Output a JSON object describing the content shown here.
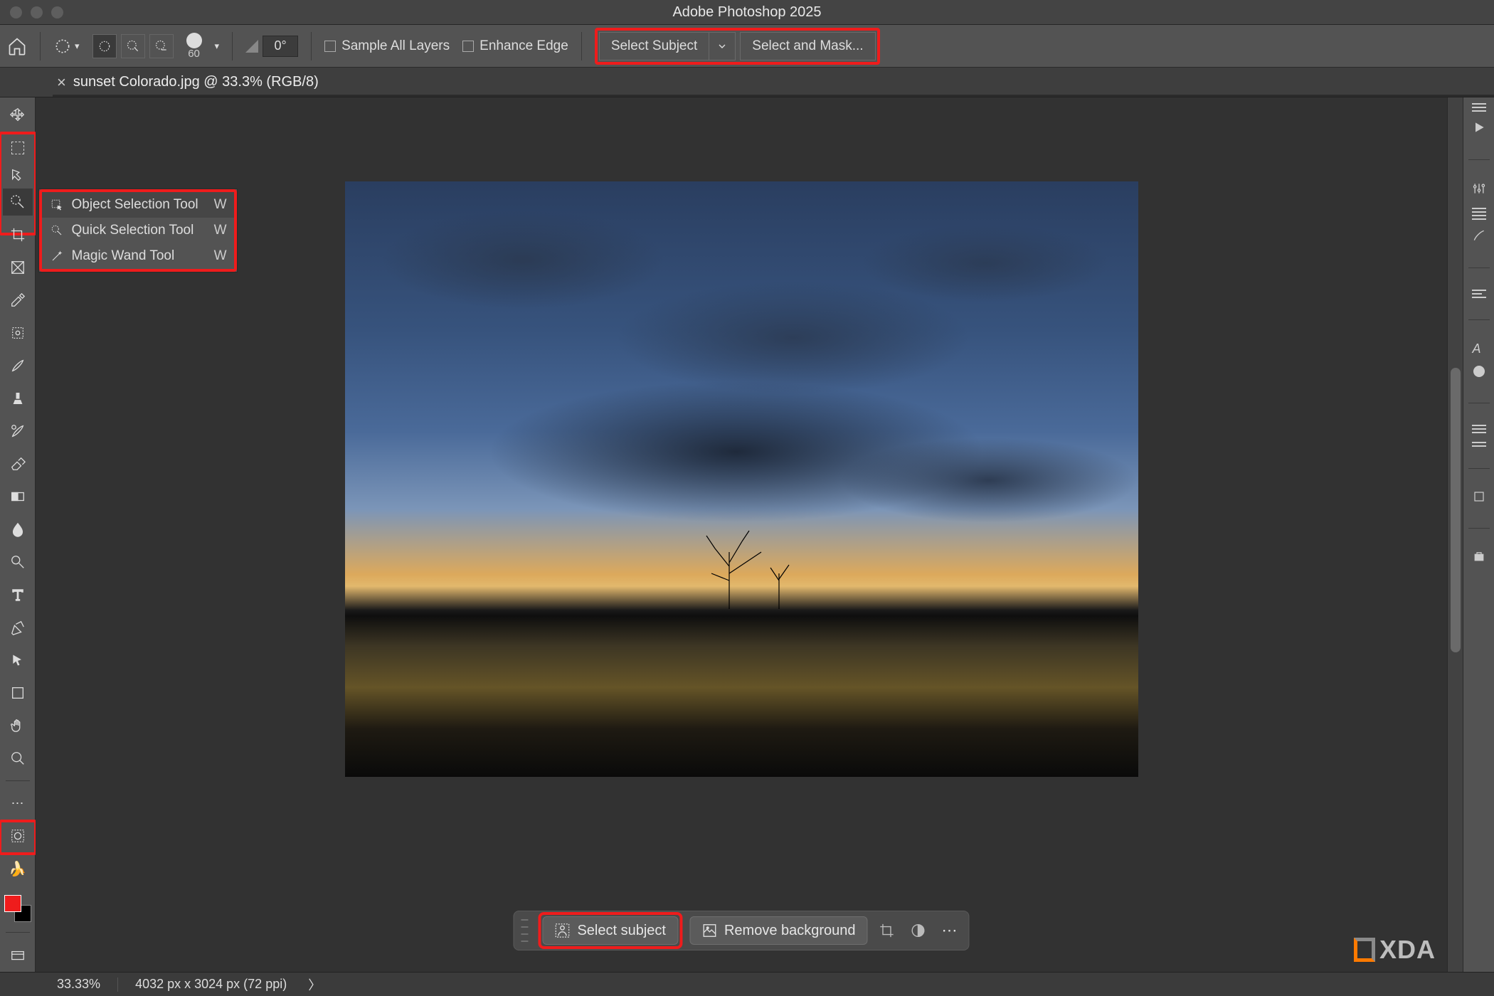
{
  "window": {
    "title": "Adobe Photoshop 2025"
  },
  "tab": {
    "filename": "sunset Colorado.jpg @ 33.3% (RGB/8)"
  },
  "options_bar": {
    "brush_size": "60",
    "angle": "0°",
    "sample_all_layers": "Sample All Layers",
    "enhance_edge": "Enhance Edge",
    "select_subject": "Select Subject",
    "select_and_mask": "Select and Mask..."
  },
  "tool_flyout": {
    "items": [
      {
        "label": "Object Selection Tool",
        "shortcut": "W"
      },
      {
        "label": "Quick Selection Tool",
        "shortcut": "W"
      },
      {
        "label": "Magic Wand Tool",
        "shortcut": "W"
      }
    ]
  },
  "context_bar": {
    "select_subject": "Select subject",
    "remove_background": "Remove background"
  },
  "status": {
    "zoom": "33.33%",
    "dims": "4032 px x 3024 px (72 ppi)"
  },
  "watermark": "XDA",
  "toolbox": [
    "move",
    "marquee",
    "lasso",
    "quick-select",
    "crop",
    "frame",
    "eyedropper",
    "healing",
    "brush",
    "clone",
    "history-brush",
    "eraser",
    "gradient",
    "blur",
    "dodge",
    "pen",
    "type",
    "path-select",
    "direct-select",
    "shape",
    "hand",
    "zoom",
    "edit-toolbar",
    "quick-mask"
  ],
  "right_panels": [
    "properties",
    "play",
    "adjustments-1",
    "adjustments-2",
    "brushes",
    "paragraph",
    "layers",
    "channels",
    "paths",
    "library",
    "libraries"
  ]
}
